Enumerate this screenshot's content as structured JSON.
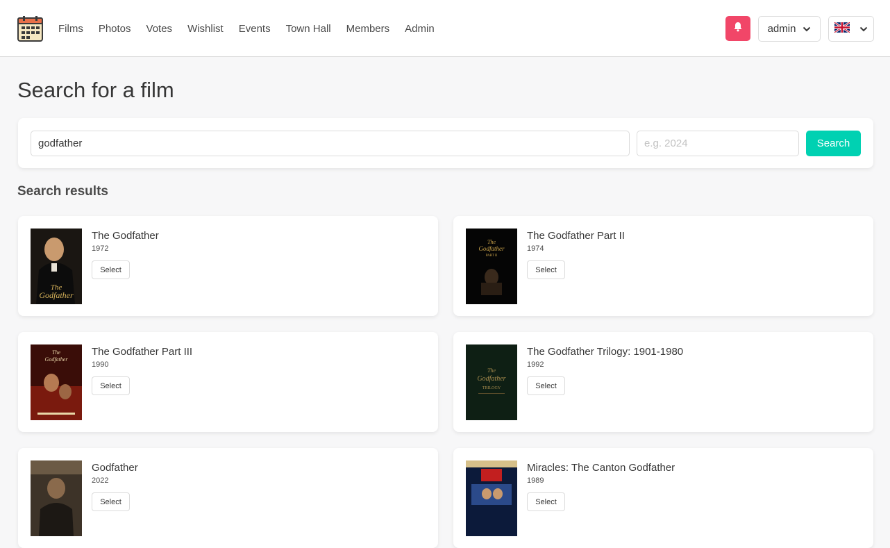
{
  "nav": {
    "links": [
      "Films",
      "Photos",
      "Votes",
      "Wishlist",
      "Events",
      "Town Hall",
      "Members",
      "Admin"
    ],
    "user_label": "admin",
    "notification_icon": "bell-icon",
    "language_icon": "uk-flag-icon"
  },
  "page": {
    "title": "Search for a film",
    "results_heading": "Search results"
  },
  "search": {
    "query_value": "godfather",
    "year_placeholder": "e.g. 2024",
    "button_label": "Search"
  },
  "results": [
    {
      "title": "The Godfather",
      "year": "1972",
      "select_label": "Select"
    },
    {
      "title": "The Godfather Part II",
      "year": "1974",
      "select_label": "Select"
    },
    {
      "title": "The Godfather Part III",
      "year": "1990",
      "select_label": "Select"
    },
    {
      "title": "The Godfather Trilogy: 1901-1980",
      "year": "1992",
      "select_label": "Select"
    },
    {
      "title": "Godfather",
      "year": "2022",
      "select_label": "Select"
    },
    {
      "title": "Miracles: The Canton Godfather",
      "year": "1989",
      "select_label": "Select"
    }
  ],
  "colors": {
    "accent": "#00d1b2",
    "notification": "#f14668"
  }
}
